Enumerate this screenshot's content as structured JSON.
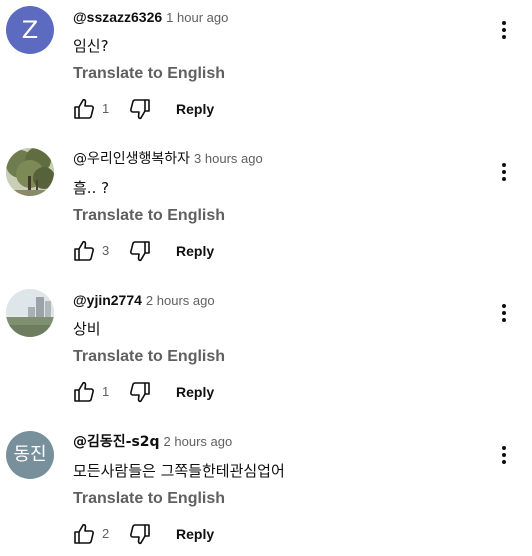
{
  "reply_label": "Reply",
  "translate_label": "Translate to English",
  "icons": {
    "like": "thumb-up-outline",
    "dislike": "thumb-down-outline",
    "more": "three-dot-vertical"
  },
  "comments": [
    {
      "author": "@sszazz6326",
      "time": "1 hour ago",
      "text": "임신?",
      "likes": "1",
      "avatar": {
        "type": "letter",
        "letter": "Z",
        "color": "#5c6bc0"
      }
    },
    {
      "author": "@우리인생행복하자",
      "time": "3 hours ago",
      "text": "흠.. ?",
      "likes": "3",
      "avatar": {
        "type": "photo",
        "subject": "tree"
      }
    },
    {
      "author": "@yjin2774",
      "time": "2 hours ago",
      "text": "상비",
      "likes": "1",
      "avatar": {
        "type": "photo",
        "subject": "city"
      }
    },
    {
      "author": "@김동진-s2q",
      "time": "2 hours ago",
      "text": "모든사람들은 그쪽들한테관심업어",
      "likes": "2",
      "avatar": {
        "type": "letter",
        "letter": "동진",
        "color": "#78909c"
      }
    }
  ]
}
